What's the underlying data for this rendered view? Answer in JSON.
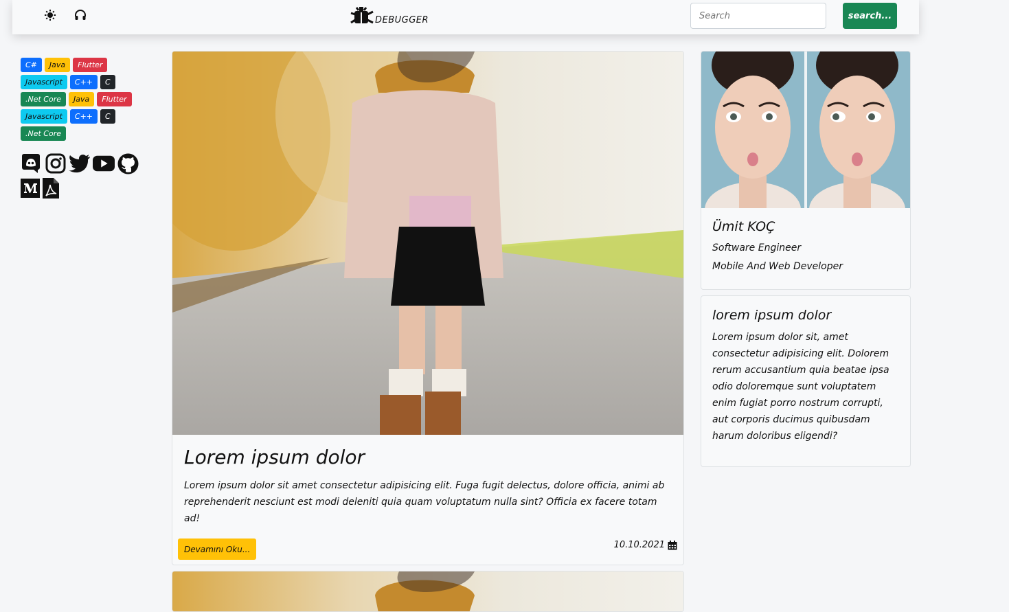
{
  "navbar": {
    "left_icons": [
      "sun-icon",
      "headphones-icon"
    ],
    "brand_text": "DEBUGGER",
    "search_placeholder": "Search",
    "search_button": "search..."
  },
  "tags": [
    [
      {
        "label": "C#",
        "color": "#0d6efd"
      },
      {
        "label": "Java",
        "color": "#ffc107"
      },
      {
        "label": "Flutter",
        "color": "#dc3545"
      }
    ],
    [
      {
        "label": "Javascript",
        "color": "#0dcaf0"
      },
      {
        "label": "C++",
        "color": "#0d6efd"
      },
      {
        "label": "C",
        "color": "#212529"
      }
    ],
    [
      {
        "label": ".Net Core",
        "color": "#198754"
      },
      {
        "label": "Java",
        "color": "#ffc107"
      },
      {
        "label": "Flutter",
        "color": "#dc3545"
      }
    ],
    [
      {
        "label": "Javascript",
        "color": "#0dcaf0"
      },
      {
        "label": "C++",
        "color": "#0d6efd"
      },
      {
        "label": "C",
        "color": "#212529"
      }
    ],
    [
      {
        "label": ".Net Core",
        "color": "#198754"
      }
    ]
  ],
  "socials": [
    "discord-icon",
    "instagram-icon",
    "twitter-icon",
    "youtube-icon",
    "github-icon",
    "medium-icon",
    "pdf-icon"
  ],
  "post": {
    "title": "Lorem ipsum dolor",
    "body": "Lorem ipsum dolor sit amet consectetur adipisicing elit. Fuga fugit delectus, dolore officia, animi ab reprehenderit nesciunt est modi deleniti quia quam voluptatum nulla sint? Officia ex facere totam ad!",
    "read_more": "Devamını Oku...",
    "date": "10.10.2021"
  },
  "profile": {
    "name": "Ümit KOÇ",
    "role": "Software Engineer",
    "subtitle": "Mobile And Web Developer"
  },
  "about": {
    "title": "lorem ipsum dolor",
    "body": "Lorem ipsum dolor sit, amet consectetur adipisicing elit. Dolorem rerum accusantium quia beatae ipsa odio doloremque sunt voluptatem enim fugiat porro nostrum corrupti, aut corporis ducimus quibusdam harum doloribus eligendi?"
  },
  "colors": {
    "primary": "#0d6efd",
    "warning": "#ffc107",
    "danger": "#dc3545",
    "info": "#0dcaf0",
    "dark": "#212529",
    "success": "#198754"
  }
}
